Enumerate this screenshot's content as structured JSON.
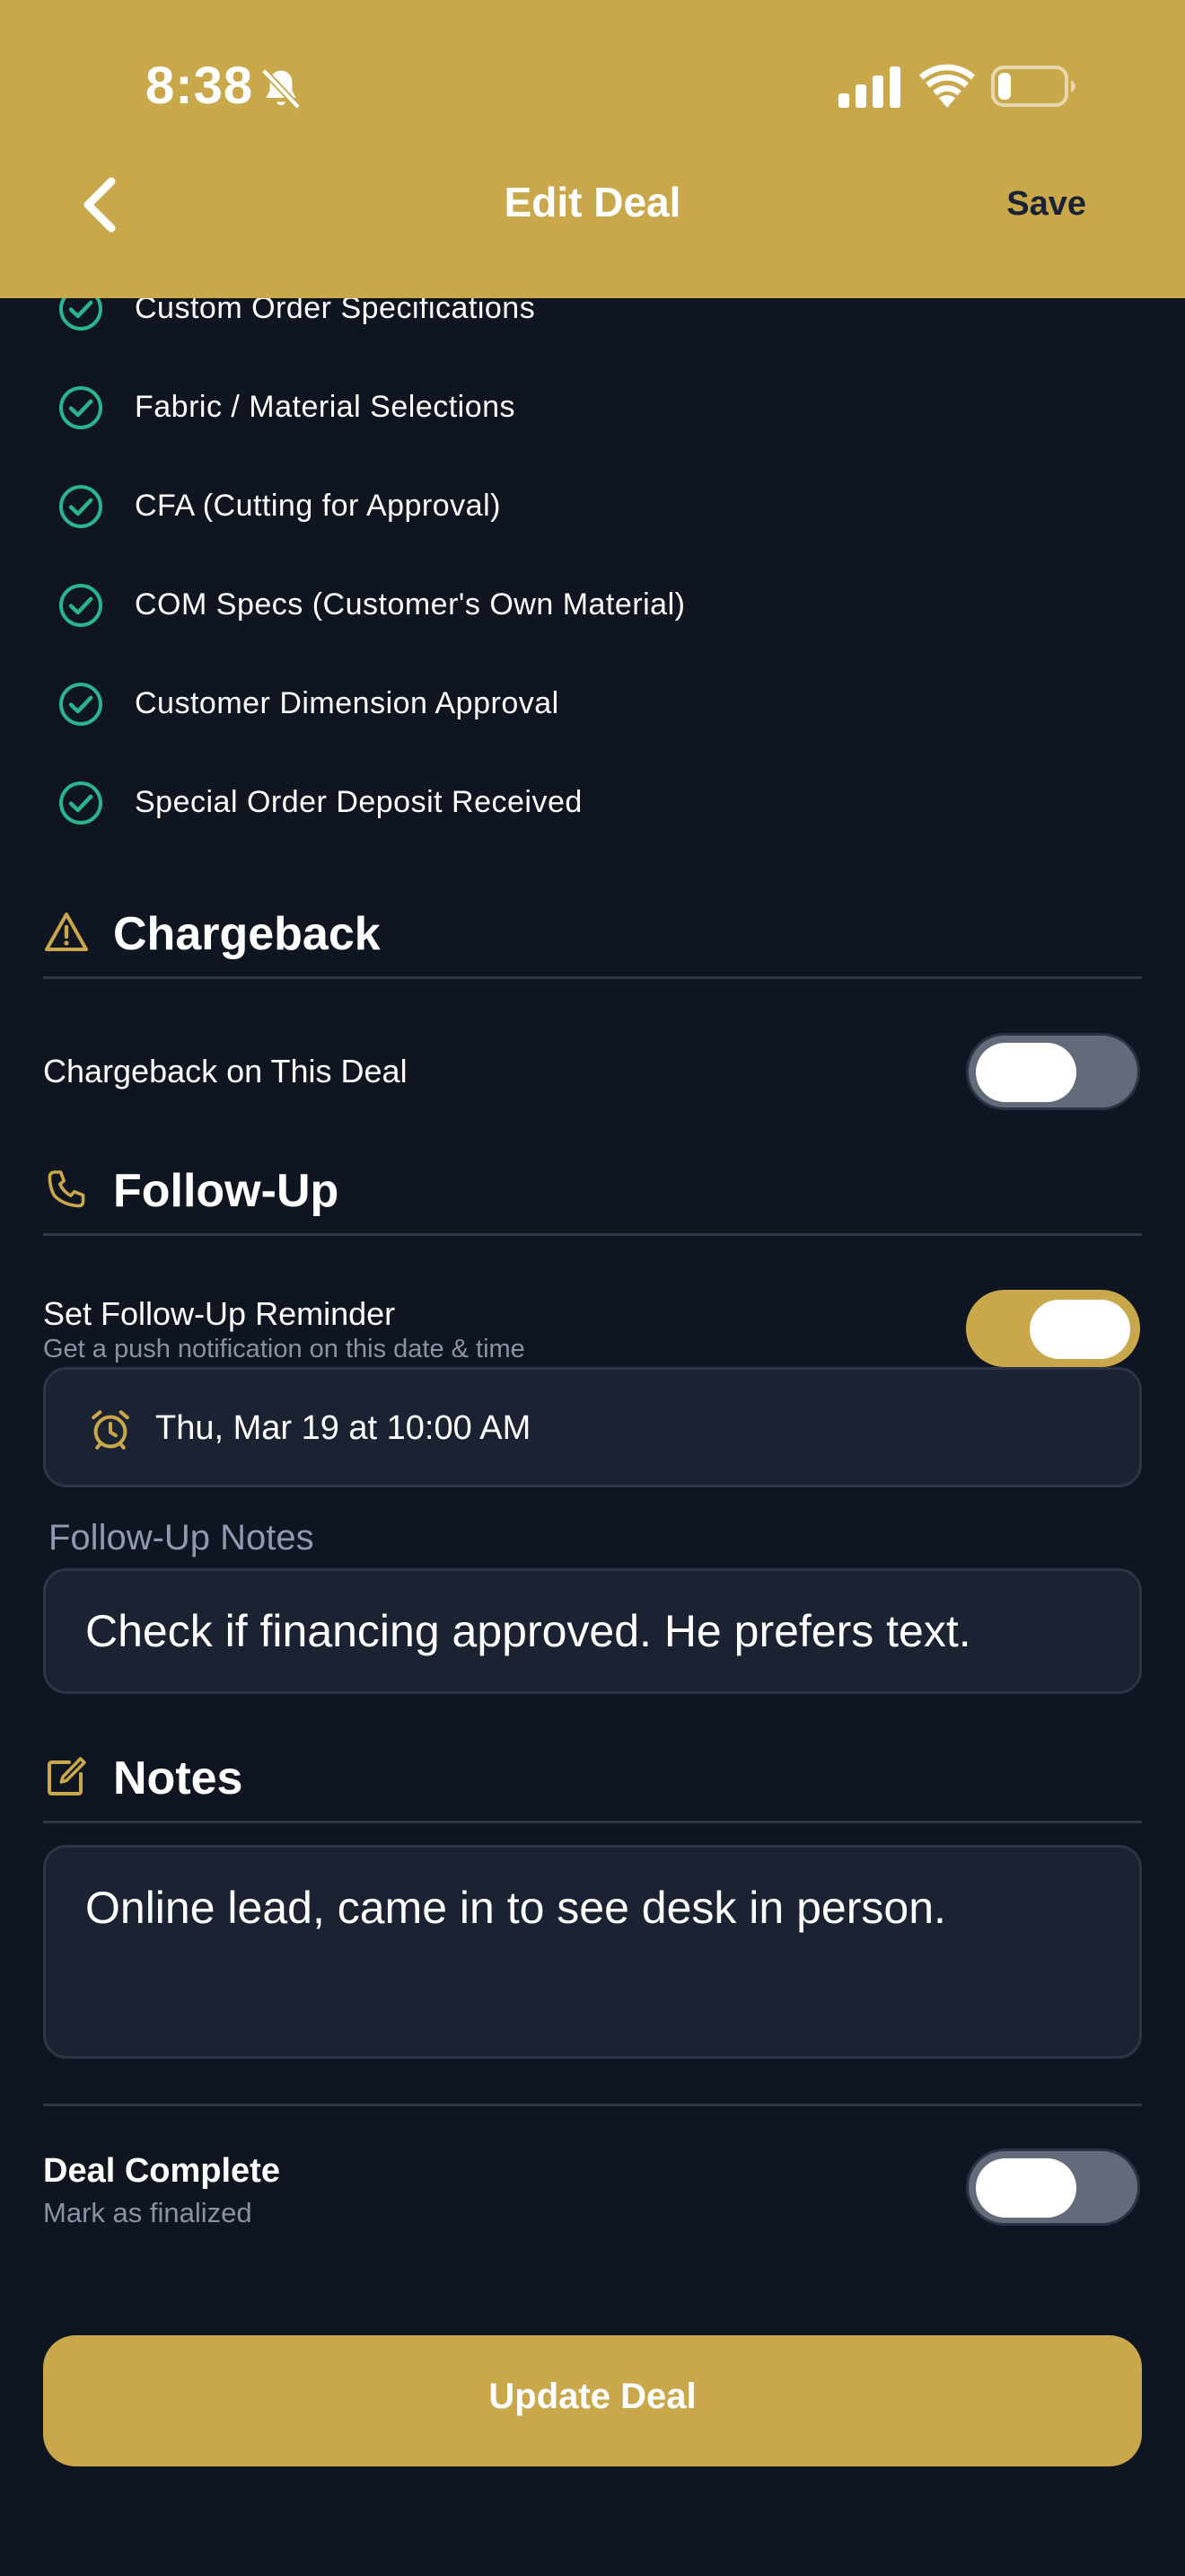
{
  "status_bar": {
    "time": "8:38"
  },
  "header": {
    "title": "Edit Deal",
    "save_label": "Save"
  },
  "checklist": [
    {
      "label": "Custom Order Specifications",
      "checked": true
    },
    {
      "label": "Fabric / Material Selections",
      "checked": true
    },
    {
      "label": "CFA (Cutting for Approval)",
      "checked": true
    },
    {
      "label": "COM Specs (Customer's Own Material)",
      "checked": true
    },
    {
      "label": "Customer Dimension Approval",
      "checked": true
    },
    {
      "label": "Special Order Deposit Received",
      "checked": true
    }
  ],
  "chargeback": {
    "title": "Chargeback",
    "toggle_label": "Chargeback on This Deal",
    "enabled": false
  },
  "follow_up": {
    "title": "Follow-Up",
    "reminder_label": "Set Follow-Up Reminder",
    "reminder_sub": "Get a push notification on this date & time",
    "enabled": true,
    "reminder_datetime": "Thu, Mar 19 at 10:00 AM",
    "notes_label": "Follow-Up Notes",
    "notes_value": "Check if financing approved. He prefers text."
  },
  "notes": {
    "title": "Notes",
    "value": "Online lead, came in to see desk in person."
  },
  "deal_complete": {
    "label": "Deal Complete",
    "sub": "Mark as finalized",
    "enabled": false
  },
  "update_button": {
    "label": "Update Deal"
  },
  "colors": {
    "accent": "#c9a84c",
    "background": "#0f1521",
    "check_green": "#2bb58f",
    "field_bg": "#1b2333"
  },
  "icons": {
    "back": "chevron-left-icon",
    "checklist": "check-circle-icon",
    "chargeback": "warning-triangle-icon",
    "follow_up": "phone-icon",
    "reminder": "alarm-clock-icon",
    "notes": "edit-square-icon"
  }
}
